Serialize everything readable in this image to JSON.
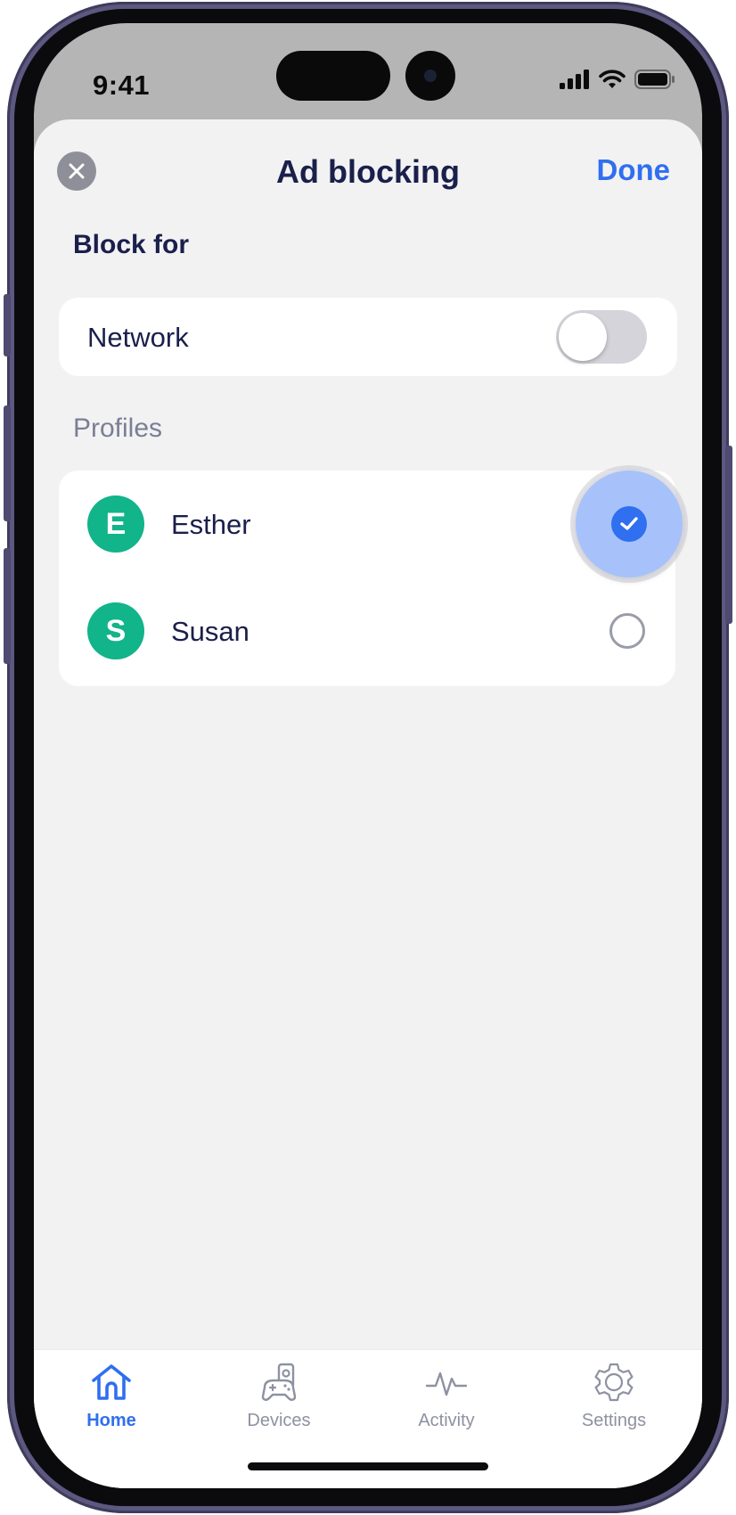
{
  "status_bar": {
    "time": "9:41"
  },
  "header": {
    "title": "Ad blocking",
    "done_label": "Done"
  },
  "block_for": {
    "heading": "Block for",
    "network": {
      "label": "Network",
      "enabled": false
    }
  },
  "profiles": {
    "heading": "Profiles",
    "items": [
      {
        "initial": "E",
        "name": "Esther",
        "selected": true
      },
      {
        "initial": "S",
        "name": "Susan",
        "selected": false
      }
    ]
  },
  "tabbar": {
    "tabs": [
      {
        "label": "Home",
        "icon": "home-icon",
        "active": true
      },
      {
        "label": "Devices",
        "icon": "devices-icon",
        "active": false
      },
      {
        "label": "Activity",
        "icon": "activity-icon",
        "active": false
      },
      {
        "label": "Settings",
        "icon": "settings-icon",
        "active": false
      }
    ]
  },
  "colors": {
    "accent": "#2f6ff0",
    "avatar": "#12b48a",
    "text_primary": "#1a1f4b",
    "background": "#f2f2f3"
  }
}
